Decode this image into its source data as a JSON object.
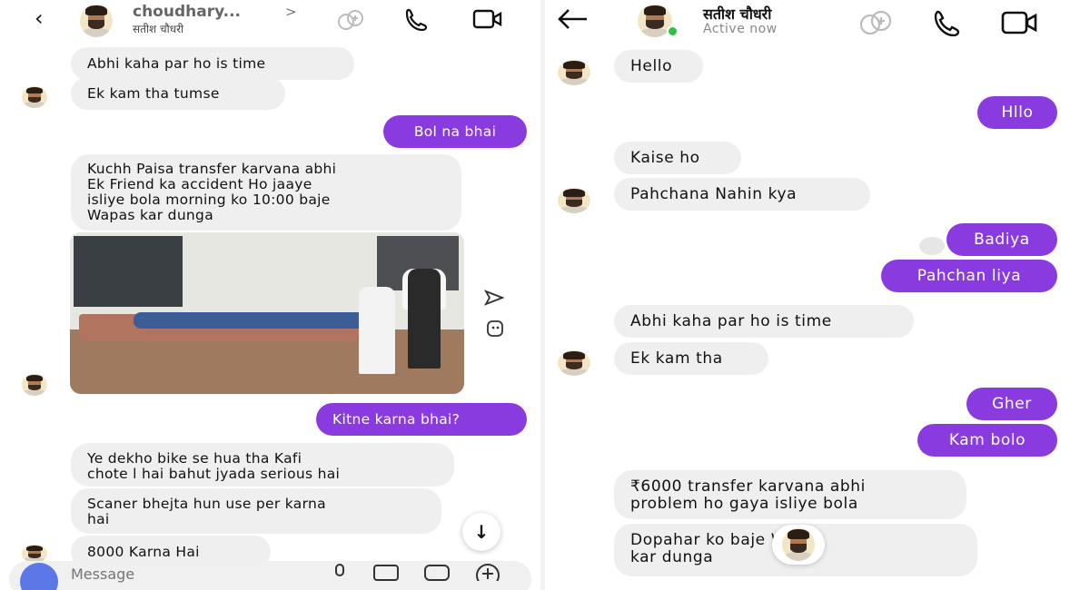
{
  "left": {
    "header": {
      "back_icon": "back-arrow-icon",
      "name": "choudhary...",
      "chevron": ">",
      "subname": "सतीश चौधरी",
      "icons": [
        "add-people-icon",
        "phone-icon",
        "video-icon"
      ]
    },
    "messages": [
      {
        "dir": "in",
        "text": "Abhi kaha par ho is time"
      },
      {
        "dir": "in",
        "text": "Ek kam tha tumse"
      },
      {
        "dir": "out",
        "text": "Bol na bhai"
      },
      {
        "dir": "in",
        "text": "Kuchh Paisa transfer karvana abhi\nEk Friend ka accident Ho jaaye\nisliye bola morning ko 10:00 baje\nWapas kar dunga"
      },
      {
        "dir": "out",
        "text": "Kitne karna bhai?"
      },
      {
        "dir": "in",
        "text": "Ye dekho bike se hua tha Kafi\nchote l hai bahut jyada serious hai"
      },
      {
        "dir": "in",
        "text": "Scaner bhejta hun use per karna\nhai"
      },
      {
        "dir": "in",
        "text": "8000 Karna Hai"
      }
    ],
    "photo_icons": [
      "send-icon",
      "sticker-icon"
    ],
    "scroll_icon": "↓",
    "composer": {
      "placeholder": "Message",
      "icons": [
        "mic-icon",
        "gallery-icon",
        "sticker-icon",
        "plus-icon"
      ]
    }
  },
  "right": {
    "header": {
      "back_icon": "back-arrow-icon",
      "name": "सतीश चौधरी",
      "status": "Active now",
      "status_color": "#2fbf4a",
      "icons": [
        "add-people-icon",
        "phone-icon",
        "video-icon"
      ]
    },
    "messages": [
      {
        "dir": "in",
        "text": "Hello"
      },
      {
        "dir": "out",
        "text": "Hllo"
      },
      {
        "dir": "in",
        "text": "Kaise ho"
      },
      {
        "dir": "in",
        "text": "Pahchana Nahin kya"
      },
      {
        "dir": "out",
        "text": "Badiya"
      },
      {
        "dir": "out",
        "text": "Pahchan liya"
      },
      {
        "dir": "in",
        "text": "Abhi kaha par ho is time"
      },
      {
        "dir": "in",
        "text": "Ek kam tha"
      },
      {
        "dir": "out",
        "text": "Gher"
      },
      {
        "dir": "out",
        "text": "Kam bolo"
      },
      {
        "dir": "in",
        "text": "₹6000 transfer karvana abhi\nproblem ho gaya isliye bola"
      },
      {
        "dir": "in",
        "text": "Dopahar ko     baje Wapas\nkar dunga"
      }
    ]
  },
  "colors": {
    "outgoing_bubble": "#8a3be0",
    "incoming_bubble": "#efefef",
    "accent_camera": "#5b78e6"
  }
}
